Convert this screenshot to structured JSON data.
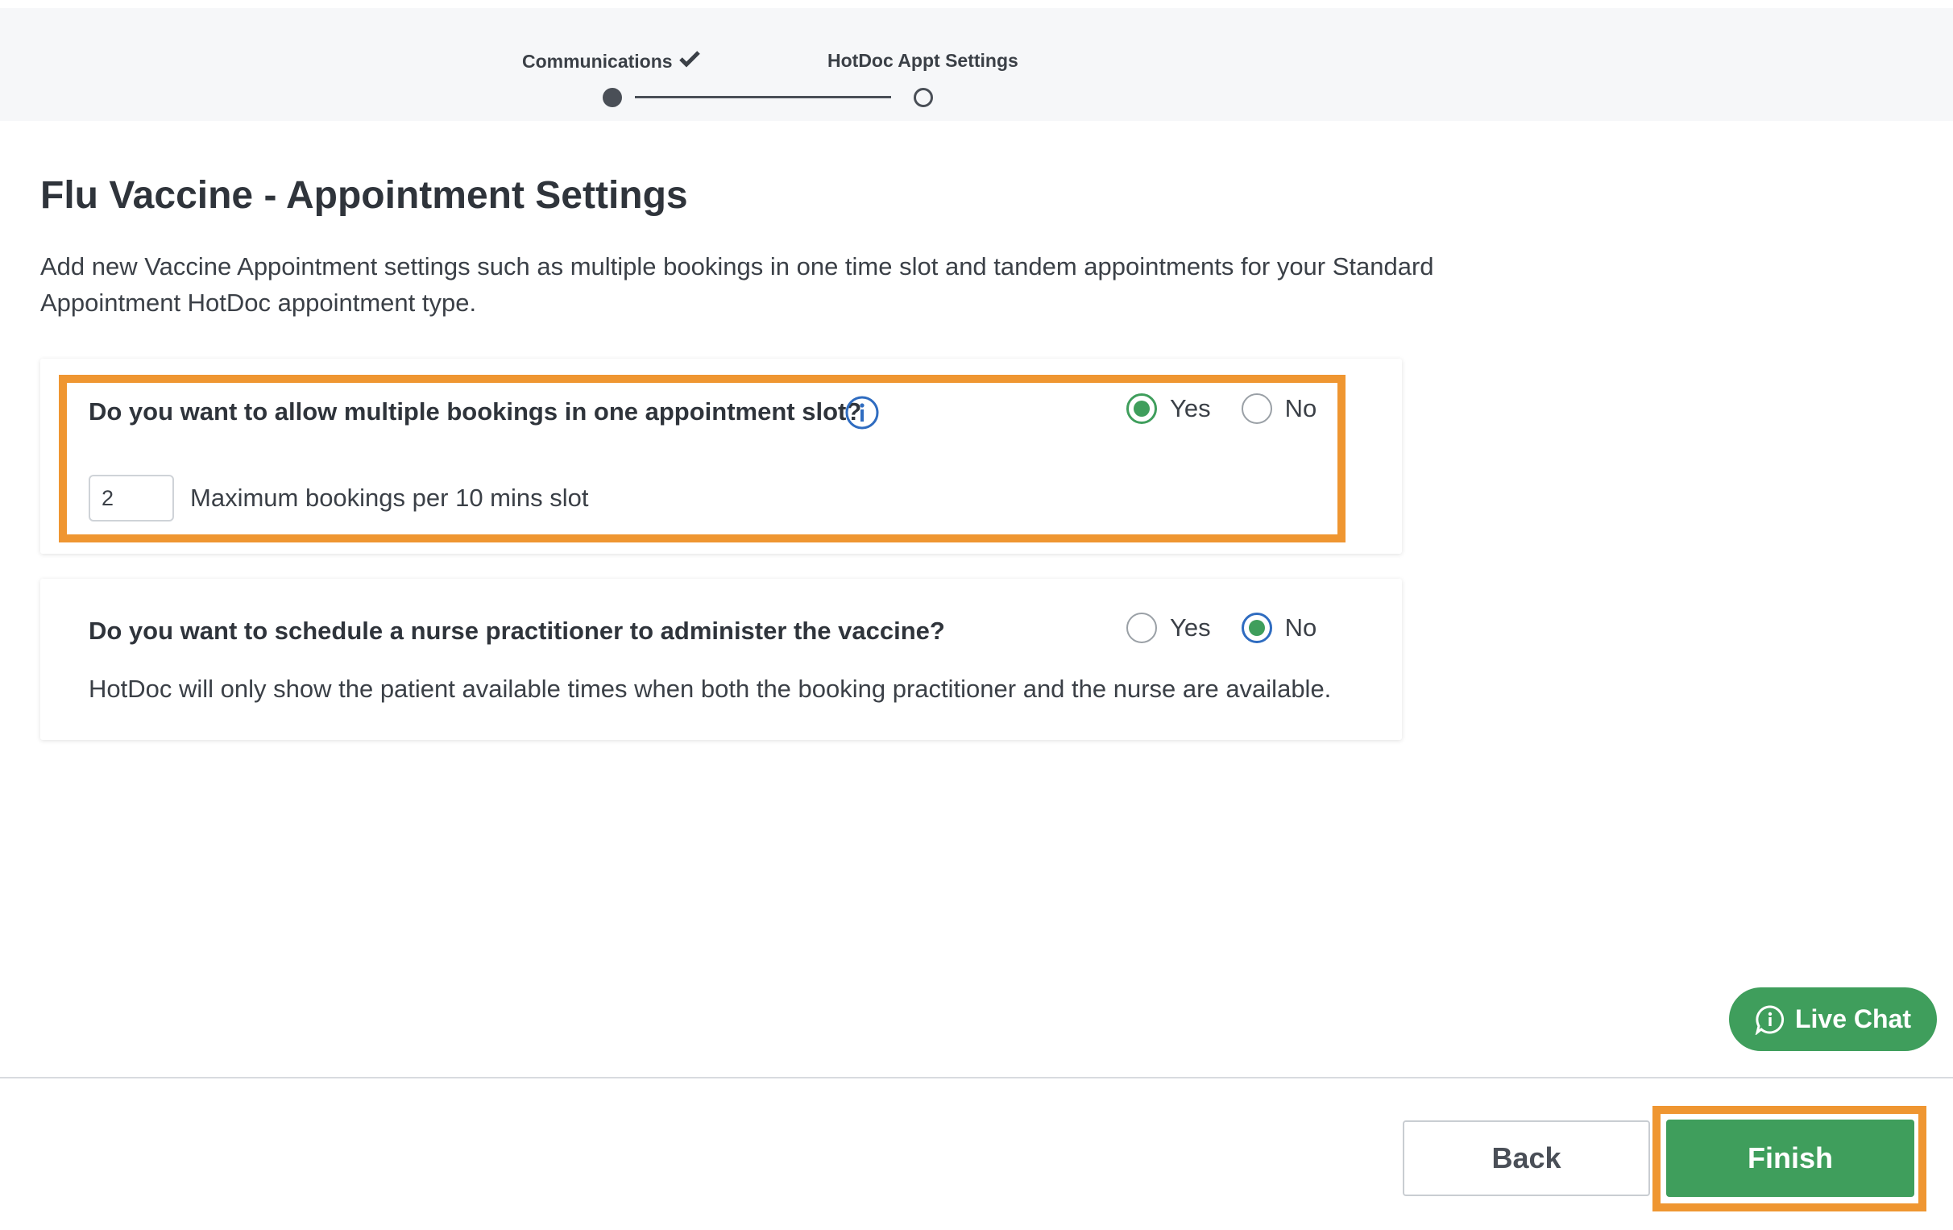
{
  "stepper": {
    "steps": [
      {
        "label": "Communications",
        "completed": true
      },
      {
        "label": "HotDoc Appt Settings",
        "completed": false
      }
    ]
  },
  "page": {
    "title": "Flu Vaccine - Appointment Settings",
    "description": "Add new Vaccine Appointment settings such as multiple bookings in one time slot and tandem appointments for your Standard Appointment HotDoc appointment type."
  },
  "multiple_bookings": {
    "question": "Do you want to allow multiple bookings in one appointment slot?",
    "yes_label": "Yes",
    "no_label": "No",
    "selected": "Yes",
    "max_bookings_value": "2",
    "max_bookings_caption": "Maximum bookings per 10 mins slot"
  },
  "nurse_practitioner": {
    "question": "Do you want to schedule a nurse practitioner to administer the vaccine?",
    "yes_label": "Yes",
    "no_label": "No",
    "selected": "No",
    "note": "HotDoc will only show the patient available times when both the booking practitioner and the nurse are available."
  },
  "live_chat": {
    "label": "Live Chat"
  },
  "footer": {
    "back_label": "Back",
    "finish_label": "Finish"
  },
  "colors": {
    "accent_green": "#3f9e5c",
    "highlight_orange": "#ef9631",
    "info_blue": "#2f6cc0"
  }
}
